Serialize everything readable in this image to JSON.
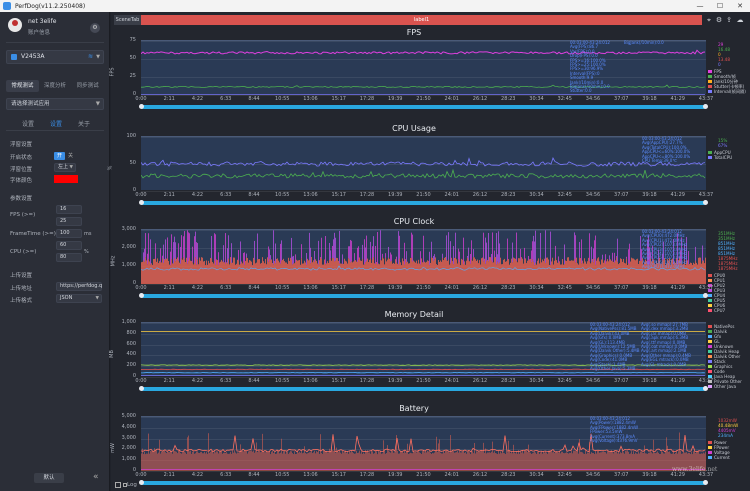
{
  "window": {
    "title": "PerfDog(v11.2.250408)",
    "min": "—",
    "max": "☐",
    "close": "✕"
  },
  "user": {
    "name": "net 3elife",
    "sub": "账户信息"
  },
  "device": {
    "name": "V2453A"
  },
  "mode_tabs": [
    "常规测试",
    "深度分析",
    "同步测试"
  ],
  "app_select": {
    "placeholder": "请选择测试应用"
  },
  "sub_tabs": [
    "设置",
    "设置",
    "关于"
  ],
  "settings": {
    "float_title": "浮窗设置",
    "enable_label": "开启状态",
    "enable_on": "开",
    "enable_off": "关",
    "position_label": "浮窗位置",
    "position_value": "左上",
    "color_label": "字体颜色",
    "color_value": "#ff0000",
    "params_title": "参数设置",
    "fps_label": "FPS (>=)",
    "fps_values": [
      "16",
      "25"
    ],
    "frametime_label": "FrameTime (>=)",
    "frametime_value": "100",
    "frametime_unit": "ms",
    "cpu_label": "CPU (>=)",
    "cpu_values": [
      "60",
      "80"
    ],
    "cpu_unit": "%",
    "upload_title": "上传设置",
    "upload_addr_label": "上传地址",
    "upload_addr_value": "https://perfdog.q",
    "upload_fmt_label": "上传格式",
    "upload_fmt_value": "JSON",
    "default_button": "默认"
  },
  "tabs": {
    "scene": "SceneTab",
    "label": "label1"
  },
  "time_axis": [
    "0:00",
    "2:11",
    "4:22",
    "6:33",
    "8:44",
    "10:55",
    "13:06",
    "15:17",
    "17:28",
    "19:39",
    "21:50",
    "24:01",
    "26:12",
    "28:23",
    "30:34",
    "32:45",
    "34:56",
    "37:07",
    "39:18",
    "41:29",
    "43:37"
  ],
  "panels": [
    {
      "title": "FPS",
      "unit": "FPS",
      "yticks": [
        "75",
        "50",
        "25",
        "0"
      ],
      "annotation_left": "00:03:00-43:24:012\nAvg(FPS):86.7\nVar(FPS):0.0\nDrop(FPS):0.0\nFPS>=16:100.0%\nFPS>=25:100.0%\nFPS>=30:96.9%\nInterval(FPS):0\nSmooth:9.9\nJank(/10min):0.0\nBigJank(/10min):0.0\nStutter:0.0",
      "annotation_right": "BigJank(/10min):0.0",
      "legend": [
        {
          "name": "FPS",
          "color": "#e040e0"
        },
        {
          "name": "Smooth/帧",
          "color": "#4caf50"
        },
        {
          "name": "Jank/10分钟",
          "color": "#ffb020"
        },
        {
          "name": "Stutter(卡顿率)",
          "color": "#e05050"
        },
        {
          "name": "Interval(帧间隔)",
          "color": "#7a7aff"
        }
      ],
      "legend_values": [
        {
          "text": "29",
          "color": "#e040e0"
        },
        {
          "text": "16.48",
          "color": "#4caf50"
        },
        {
          "text": "0",
          "color": "#ffb020"
        },
        {
          "text": "13.48",
          "color": "#e05050"
        },
        {
          "text": "0",
          "color": "#7a7aff"
        }
      ]
    },
    {
      "title": "CPU Usage",
      "unit": "%",
      "yticks": [
        "100",
        "50",
        "0"
      ],
      "annotation_left": "",
      "annotation_right": "00:03:00-43:24:012\nAvg(AppCPU):27.7%\nAvg(TotalCPU):100.0%\nAppCPU<=60%:100.0%\nAppCPU<=80%:100.0%\nCPU Temp:39.0℃",
      "legend": [
        {
          "name": "AppCPU",
          "color": "#4caf50"
        },
        {
          "name": "TotalCPU",
          "color": "#7a7aff"
        }
      ],
      "legend_values": [
        {
          "text": "15%",
          "color": "#4caf50"
        },
        {
          "text": "67%",
          "color": "#7a7aff"
        }
      ]
    },
    {
      "title": "CPU Clock",
      "unit": "MHz",
      "yticks": [
        "3,000",
        "2,000",
        "1,000",
        "0"
      ],
      "annotation_left": "",
      "annotation_right": "00:03:00-43:24:012\nAvg(CPU0):472.0MHz\nAvg(CPU1):472.0MHz\nAvg(CPU2):1073.0MHz\nAvg(CPU3):1073.0MHz\nAvg(CPU4):1073.0MHz\nAvg(CPU5):1073.0MHz\nAvg(CPU6):1073.0MHz\nAvg(CPU7):472.0MHz",
      "legend": [
        {
          "name": "CPU0",
          "color": "#e05050"
        },
        {
          "name": "CPU1",
          "color": "#ff9050"
        },
        {
          "name": "CPU2",
          "color": "#d040d0"
        },
        {
          "name": "CPU3",
          "color": "#c050e0"
        },
        {
          "name": "CPU4",
          "color": "#50b0ff"
        },
        {
          "name": "CPU5",
          "color": "#40d0a0"
        },
        {
          "name": "CPU6",
          "color": "#ffd040"
        },
        {
          "name": "CPU7",
          "color": "#ff5070"
        }
      ],
      "legend_values": [
        {
          "text": "351MHz",
          "color": "#4caf50"
        },
        {
          "text": "351MHz",
          "color": "#4caf50"
        },
        {
          "text": "851MHz",
          "color": "#50b0ff"
        },
        {
          "text": "851MHz",
          "color": "#50b0ff"
        },
        {
          "text": "851MHz",
          "color": "#50b0ff"
        },
        {
          "text": "1875MHz",
          "color": "#e05050"
        },
        {
          "text": "1875MHz",
          "color": "#e05050"
        },
        {
          "text": "1875MHz",
          "color": "#e05050"
        }
      ]
    },
    {
      "title": "Memory Detail",
      "unit": "MB",
      "yticks": [
        "1,000",
        "800",
        "600",
        "400",
        "200",
        "0"
      ],
      "annotation_left": "00:03:00-43:24:012\nAvg(NativePss):81.5MB\nAvg(Dalvik):43.0MB\nAvg(Gfx):0.0MB\nAvg(GL):113.4MB\nAvg(Unknown):12.5MB\nAvg(Dalvik Other):5.4MB\nAvg(Graphics):0.0MB\nAvg(Code):41.0MB\nAvg(Stack):1.4MB\nAvg(Other Java):5.3MB",
      "annotation_right": "Avg(.so mmap):27.7MB\nAvg(.dex mmap):3.2MB\nAvg(.jar mmap):0.0MB\nAvg(.apk mmap):6.3MB\nAvg(.ttf mmap):0.0MB\nAvg(.oat mmap):0.0MB\nAvg(.art mmap):2.1MB\nAvg(Other mmap):0.4MB\nAvg(EGL mtrack):0.0MB\nAvg(GL mtrack):0.0MB",
      "legend": [
        {
          "name": "NativePss",
          "color": "#e05050"
        },
        {
          "name": "Dalvik",
          "color": "#4caf50"
        },
        {
          "name": "Gfx",
          "color": "#50b0ff"
        },
        {
          "name": "GL",
          "color": "#ffd040"
        },
        {
          "name": "Unknown",
          "color": "#d040d0"
        },
        {
          "name": "Dalvik Heap",
          "color": "#40d0a0"
        },
        {
          "name": "Dalvik Other",
          "color": "#ff9050"
        },
        {
          "name": "Stack",
          "color": "#7a7aff"
        },
        {
          "name": "Graphics",
          "color": "#a0e050"
        },
        {
          "name": "Code",
          "color": "#ff5070"
        },
        {
          "name": "Java Heap",
          "color": "#50d0ff"
        },
        {
          "name": "Private Other",
          "color": "#c0c0c0"
        },
        {
          "name": "Other Java",
          "color": "#e0a0ff"
        }
      ],
      "legend_values": []
    },
    {
      "title": "Battery",
      "unit": "mW",
      "yticks": [
        "5,000",
        "4,000",
        "3,000",
        "2,000",
        "1,000",
        "0"
      ],
      "annotation_left": "00:03:00-43:24:012\nAvg(Power):1882.4mW\nAvg(FPower):1882.4mW\nFPower:53.5mW\nAvg(Current):373.8mA\nAvg(Voltage):4376.9mV",
      "annotation_right": "",
      "legend": [
        {
          "name": "Power",
          "color": "#e05050"
        },
        {
          "name": "FPower",
          "color": "#ffd040"
        },
        {
          "name": "Voltage",
          "color": "#d040d0"
        },
        {
          "name": "Current",
          "color": "#50b0ff"
        }
      ],
      "legend_values": [
        {
          "text": "1032mW",
          "color": "#e05050"
        },
        {
          "text": "40.48mW",
          "color": "#ffd040"
        },
        {
          "text": "4405mV",
          "color": "#d040d0"
        },
        {
          "text": "234mA",
          "color": "#50b0ff"
        }
      ]
    }
  ],
  "status": {
    "log": "Log"
  },
  "watermark": "www.3elife.net"
}
